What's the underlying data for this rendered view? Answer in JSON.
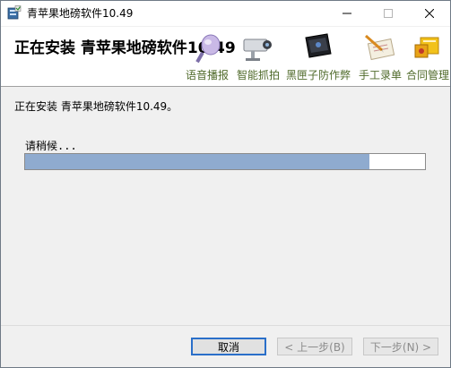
{
  "window": {
    "title": "青苹果地磅软件10.49"
  },
  "banner": {
    "title": "正在安装 青苹果地磅软件10.49",
    "features": [
      {
        "label": "语音播报",
        "icon": "microphone-icon"
      },
      {
        "label": "智能抓拍",
        "icon": "camera-icon"
      },
      {
        "label": "黑匣子防作弊",
        "icon": "black-box-icon"
      },
      {
        "label": "手工录单",
        "icon": "handwriting-icon"
      },
      {
        "label": "合同管理",
        "icon": "contract-icon"
      }
    ]
  },
  "content": {
    "status": "正在安装 青苹果地磅软件10.49。",
    "wait": "请稍候...",
    "progress_fraction": 0.86
  },
  "buttons": {
    "cancel": "取消",
    "back": "< 上一步(B)",
    "next": "下一步(N) >"
  },
  "colors": {
    "progress_fill": "#8fabcf",
    "feature_label": "#4f6a2a",
    "primary_border": "#2a6fc9"
  }
}
